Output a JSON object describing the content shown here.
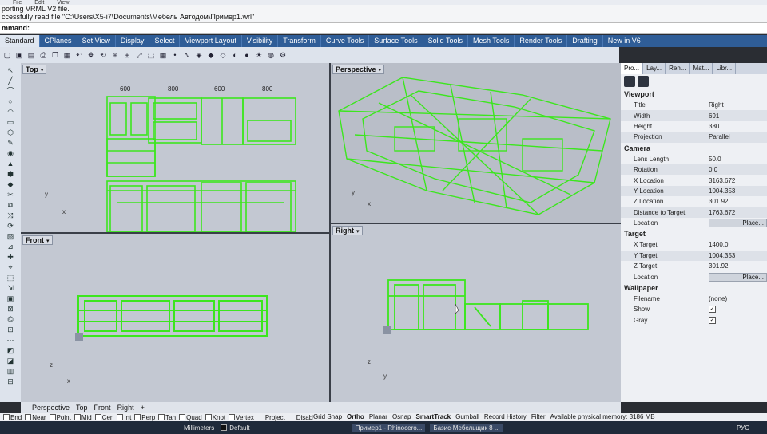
{
  "history": [
    "porting VRML V2 file.",
    "ccessfully read file \"C:\\Users\\X5-i7\\Documents\\Мебель Автодом\\Пример1.wrl\""
  ],
  "command_prompt": "mmand:",
  "tabs": [
    "Standard",
    "CPlanes",
    "Set View",
    "Display",
    "Select",
    "Viewport Layout",
    "Visibility",
    "Transform",
    "Curve Tools",
    "Surface Tools",
    "Solid Tools",
    "Mesh Tools",
    "Render Tools",
    "Drafting",
    "New in V6"
  ],
  "toolbar_icons": [
    "new-icon",
    "open-icon",
    "save-icon",
    "print-icon",
    "copy-icon",
    "paste-icon",
    "undo-icon",
    "pan-icon",
    "rotate-icon",
    "zoom-icon",
    "zoom-window-icon",
    "zoom-extents-icon",
    "select-icon",
    "grid-icon",
    "point-icon",
    "curve-icon",
    "surface-icon",
    "solid-icon",
    "mesh-icon",
    "render-icon",
    "material-icon",
    "light-icon",
    "globe-icon",
    "settings-icon"
  ],
  "viewports": {
    "top": {
      "label": "Top",
      "dims": [
        "600",
        "800",
        "600",
        "800"
      ],
      "axis_x": "x",
      "axis_y": "y"
    },
    "perspective": {
      "label": "Perspective",
      "axis_x": "x",
      "axis_y": "y"
    },
    "front": {
      "label": "Front",
      "axis_x": "x",
      "axis_y": "z"
    },
    "right": {
      "label": "Right",
      "axis_x": "y",
      "axis_y": "z"
    }
  },
  "view_tabs": [
    "Perspective",
    "Top",
    "Front",
    "Right",
    "+"
  ],
  "right_panel": {
    "tabs": [
      "Pro...",
      "Lay...",
      "Ren...",
      "Mat...",
      "Libr..."
    ],
    "viewport_section": "Viewport",
    "viewport_rows": [
      {
        "k": "Title",
        "v": "Right"
      },
      {
        "k": "Width",
        "v": "691"
      },
      {
        "k": "Height",
        "v": "380"
      },
      {
        "k": "Projection",
        "v": "Parallel"
      }
    ],
    "camera_section": "Camera",
    "camera_rows": [
      {
        "k": "Lens Length",
        "v": "50.0"
      },
      {
        "k": "Rotation",
        "v": "0.0"
      },
      {
        "k": "X Location",
        "v": "3163.672"
      },
      {
        "k": "Y Location",
        "v": "1004.353"
      },
      {
        "k": "Z Location",
        "v": "301.92"
      },
      {
        "k": "Distance to Target",
        "v": "1763.672"
      }
    ],
    "camera_location_label": "Location",
    "place_button": "Place...",
    "target_section": "Target",
    "target_rows": [
      {
        "k": "X Target",
        "v": "1400.0"
      },
      {
        "k": "Y Target",
        "v": "1004.353"
      },
      {
        "k": "Z Target",
        "v": "301.92"
      }
    ],
    "target_location_label": "Location",
    "wallpaper_section": "Wallpaper",
    "wp_filename_label": "Filename",
    "wp_filename_value": "(none)",
    "wp_show_label": "Show",
    "wp_gray_label": "Gray"
  },
  "osnap": {
    "items": [
      "End",
      "Near",
      "Point",
      "Mid",
      "Cen",
      "Int",
      "Perp",
      "Tan",
      "Quad",
      "Knot",
      "Vertex"
    ],
    "project": "Project",
    "disable": "Disable"
  },
  "status": {
    "units": "Millimeters",
    "layer": "Default",
    "toggles": [
      "Grid Snap",
      "Ortho",
      "Planar",
      "Osnap",
      "SmartTrack",
      "Gumball",
      "Record History",
      "Filter"
    ],
    "memory": "Available physical memory: 3186 MB",
    "taskbar_1": "Пример1 - Rhinocero...",
    "taskbar_2": "Базис-Мебельщик 8 ...",
    "lang": "РУС"
  },
  "colors": {
    "wire": "#3ce61e",
    "tab_bar": "#2f5d97"
  }
}
